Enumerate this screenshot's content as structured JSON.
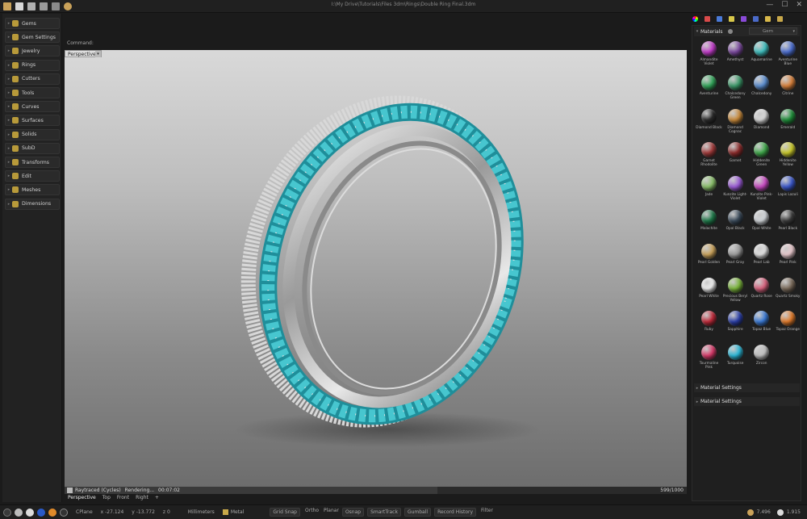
{
  "window": {
    "title": "I:\\My Drive\\Tutorials\\Files 3dm\\Rings\\Double Ring Final.3dm",
    "controls": [
      "—",
      "☐",
      "✕"
    ]
  },
  "command_label": "Command:",
  "left_panel": {
    "items": [
      {
        "label": "Gems",
        "icon": "gem-icon"
      },
      {
        "label": "Gem Settings",
        "icon": "gem-settings-icon"
      },
      {
        "label": "Jewelry",
        "icon": "jewelry-icon"
      },
      {
        "label": "Rings",
        "icon": "ring-icon"
      },
      {
        "label": "Cutters",
        "icon": "cutter-icon"
      },
      {
        "label": "Tools",
        "icon": "tools-icon"
      },
      {
        "label": "Curves",
        "icon": "curve-icon"
      },
      {
        "label": "Surfaces",
        "icon": "surface-icon"
      },
      {
        "label": "Solids",
        "icon": "solid-icon"
      },
      {
        "label": "SubD",
        "icon": "subd-icon"
      },
      {
        "label": "Transforms",
        "icon": "transform-icon"
      },
      {
        "label": "Edit",
        "icon": "edit-icon"
      },
      {
        "label": "Meshes",
        "icon": "mesh-icon"
      },
      {
        "label": "Dimensions",
        "icon": "dimension-icon"
      }
    ]
  },
  "viewport": {
    "active_tab": "Perspective",
    "status_renderer": "Raytraced (Cycles)",
    "status_state": "Rendering...",
    "status_time": "00:07:02",
    "passes": "599/1000",
    "progress": 0.599
  },
  "view_tabs": [
    "Perspective",
    "Top",
    "Front",
    "Right",
    "+"
  ],
  "statusbar": {
    "cplane": "CPlane",
    "x": "x -27.124",
    "y": "y -13.772",
    "z": "z 0",
    "units": "Millimeters",
    "layer": "Metal",
    "toggles": [
      {
        "label": "Grid Snap",
        "on": true
      },
      {
        "label": "Ortho",
        "on": false
      },
      {
        "label": "Planar",
        "on": false
      },
      {
        "label": "Osnap",
        "on": true
      },
      {
        "label": "SmartTrack",
        "on": true
      },
      {
        "label": "Gumball",
        "on": true
      },
      {
        "label": "Record History",
        "on": true
      },
      {
        "label": "Filter",
        "on": false
      }
    ],
    "right_value_1": "7.496",
    "right_value_2": "1.915"
  },
  "materials_panel": {
    "title": "Materials",
    "dropdown": "Gem",
    "settings_1": "Material Settings",
    "settings_2": "Material Settings",
    "materials": [
      {
        "name": "Almandite Violet",
        "color": "#c13cc9"
      },
      {
        "name": "Amethyst",
        "color": "#7c4aa0"
      },
      {
        "name": "Aquamarine",
        "color": "#3fbfbf"
      },
      {
        "name": "Aventurine Blue",
        "color": "#4c6ed0"
      },
      {
        "name": "Aventurine",
        "color": "#32a65a"
      },
      {
        "name": "Chalcedony Green",
        "color": "#3c9a6a"
      },
      {
        "name": "Chalcedony",
        "color": "#5b8ed1"
      },
      {
        "name": "Citrine",
        "color": "#d8803a"
      },
      {
        "name": "Diamond Black",
        "color": "#2a2a2a"
      },
      {
        "name": "Diamond Cognac",
        "color": "#c98a3a"
      },
      {
        "name": "Diamond",
        "color": "#d8d8d8"
      },
      {
        "name": "Emerald",
        "color": "#1f8f3a"
      },
      {
        "name": "Garnet Rhodolite",
        "color": "#a13a3a"
      },
      {
        "name": "Garnet",
        "color": "#8c2a2a"
      },
      {
        "name": "Hiddenite Green",
        "color": "#3fa84a"
      },
      {
        "name": "Hiddenite Yellow",
        "color": "#c9c82a"
      },
      {
        "name": "Jade",
        "color": "#8abf6a"
      },
      {
        "name": "Kunzite Light-Violet",
        "color": "#9a5ad6"
      },
      {
        "name": "Kunzite Pink-Violet",
        "color": "#c84ac2"
      },
      {
        "name": "Lapis Lazuli",
        "color": "#3a56c9"
      },
      {
        "name": "Malachite",
        "color": "#1f7a4a"
      },
      {
        "name": "Opal Black",
        "color": "#3a4a5a"
      },
      {
        "name": "Opal White",
        "color": "#d0d4d8"
      },
      {
        "name": "Pearl Black",
        "color": "#3a3a3a"
      },
      {
        "name": "Pearl Golden",
        "color": "#caa25a"
      },
      {
        "name": "Pearl Gray",
        "color": "#9a9a9a"
      },
      {
        "name": "Pearl Lab",
        "color": "#e0e0e0"
      },
      {
        "name": "Pearl Pink",
        "color": "#e8c8cc"
      },
      {
        "name": "Pearl White",
        "color": "#efefef"
      },
      {
        "name": "Precious Beryl Yellow",
        "color": "#7ab53a"
      },
      {
        "name": "Quartz Rose",
        "color": "#d8627e"
      },
      {
        "name": "Quartz Smoky",
        "color": "#7a6a5a"
      },
      {
        "name": "Ruby",
        "color": "#c02a3a"
      },
      {
        "name": "Sapphire",
        "color": "#2a3ea8"
      },
      {
        "name": "Topaz Blue",
        "color": "#3a7ad6"
      },
      {
        "name": "Topaz Orange",
        "color": "#e07a2a"
      },
      {
        "name": "Tourmaline Pink",
        "color": "#d83a6a"
      },
      {
        "name": "Turquoise",
        "color": "#2ab8d8"
      },
      {
        "name": "Zircon",
        "color": "#c0c0c0"
      }
    ]
  }
}
